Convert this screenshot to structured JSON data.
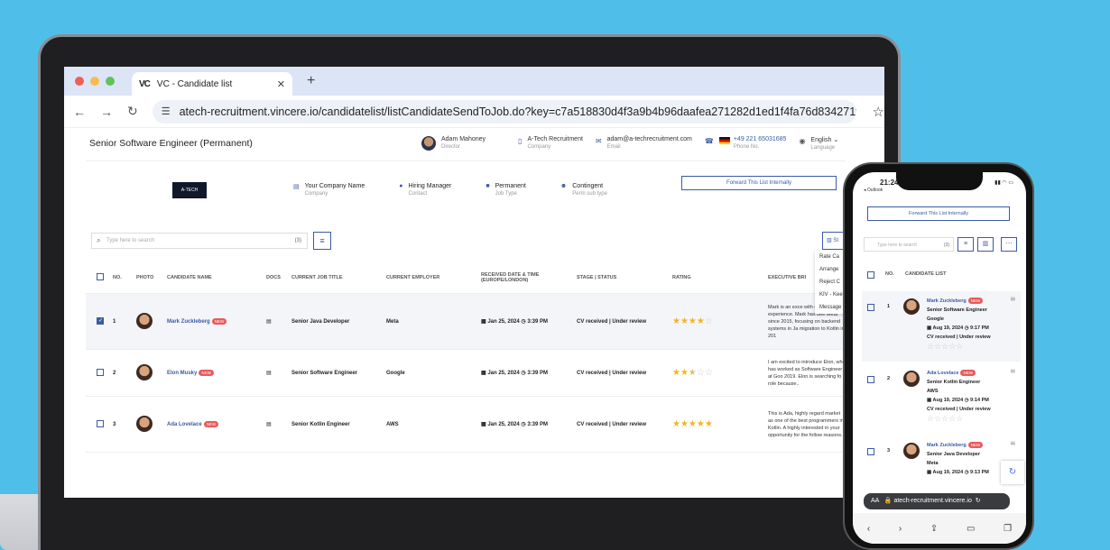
{
  "browser": {
    "tab_logo": "VC",
    "tab_title": "VC - Candidate list",
    "url": "atech-recruitment.vincere.io/candidatelist/listCandidateSendToJob.do?key=c7a518830d4f3a9b4b96daafea271282d1ed1f4fa76d834271f69..."
  },
  "header": {
    "job_title": "Senior Software Engineer (Permanent)",
    "contact_name": "Adam Mahoney",
    "contact_role": "Director",
    "company": "A-Tech Recruitment",
    "company_label": "Company",
    "email": "adam@a-techrecruitment.com",
    "email_label": "Email",
    "phone": "+49 221 65031685",
    "phone_label": "Phone No.",
    "language": "English",
    "language_label": "Language"
  },
  "card": {
    "logo_text": "A-TECH",
    "company": "Your Company Name",
    "company_label": "Company",
    "manager": "Hiring Manager",
    "manager_label": "Contact",
    "job_type": "Permanent",
    "job_type_label": "Job Type",
    "sub_type": "Contingent",
    "sub_type_label": "Perm sub type",
    "forward_label": "Forward This List Internally"
  },
  "search": {
    "placeholder": "Type here to search",
    "count": "(3)"
  },
  "stats_label": "St",
  "menu": [
    "Rate Ca",
    "Arrange",
    "Reject C",
    "KIV - Kee",
    "Message"
  ],
  "table": {
    "headers": [
      "NO.",
      "PHOTO",
      "CANDIDATE NAME",
      "DOCS",
      "CURRENT JOB TITLE",
      "CURRENT EMPLOYER",
      "RECEIVED DATE & TIME (EUROPE/LONDON)",
      "STAGE | STATUS",
      "RATING",
      "EXECUTIVE BRI"
    ],
    "new_badge": "NEW",
    "rows": [
      {
        "no": "1",
        "name": "Mark Zuckleberg",
        "job": "Senior Java Developer",
        "employer": "Meta",
        "date": "Jan 25, 2024",
        "time": "3:39 PM",
        "status": "CV received | Under review",
        "rating": 4,
        "brief": "Mark is an exce with over 14 ye experience. Mark has bee Meta since 2015, focusing on backend systems in Ja migration to Kotlin in 201"
      },
      {
        "no": "2",
        "name": "Elon Musky",
        "job": "Senior Software Engineer",
        "employer": "Google",
        "date": "Jan 25, 2024",
        "time": "3:39 PM",
        "status": "CV received | Under review",
        "rating": 2.5,
        "brief": "I am excited to introduce Elon, who has worked as Software Engineer at Goo 2019. Elon is searching fo role because.."
      },
      {
        "no": "3",
        "name": "Ada Lovelace",
        "job": "Senior Kotlin Engineer",
        "employer": "AWS",
        "date": "Jan 25, 2024",
        "time": "3:39 PM",
        "status": "CV received | Under review",
        "rating": 5,
        "brief": "This is Ada, highly regard market as one of the best programmers in Kotlin. A highly interested in your opportunity for the follow reasons..."
      }
    ]
  },
  "phone": {
    "time": "21:24",
    "back_app": "◂ Outlook",
    "forward_label": "Forward This List Internally",
    "search_placeholder": "Type here to search",
    "count": "(3)",
    "col_no": "NO.",
    "col_list": "CANDIDATE LIST",
    "url": "atech-recruitment.vincere.io",
    "text_size": "AA",
    "rows": [
      {
        "no": "1",
        "name": "Mark Zuckleberg",
        "job": "Senior Software Engineer",
        "employer": "Google",
        "date": "Aug 19, 2024",
        "time": "9:17 PM",
        "status": "CV received | Under review"
      },
      {
        "no": "2",
        "name": "Ada Lovelace",
        "job": "Senior Kotlin Engineer",
        "employer": "AWS",
        "date": "Aug 19, 2024",
        "time": "9:14 PM",
        "status": "CV received | Under review"
      },
      {
        "no": "3",
        "name": "Mark Zuckleberg",
        "job": "Senior Java Developer",
        "employer": "Meta",
        "date": "Aug 19, 2024",
        "time": "9:13 PM",
        "status": ""
      }
    ]
  },
  "colors": {
    "accent": "#3b5ba5",
    "background": "#4fbfea",
    "new_badge": "#e85a5a",
    "star": "#f3b41f"
  }
}
